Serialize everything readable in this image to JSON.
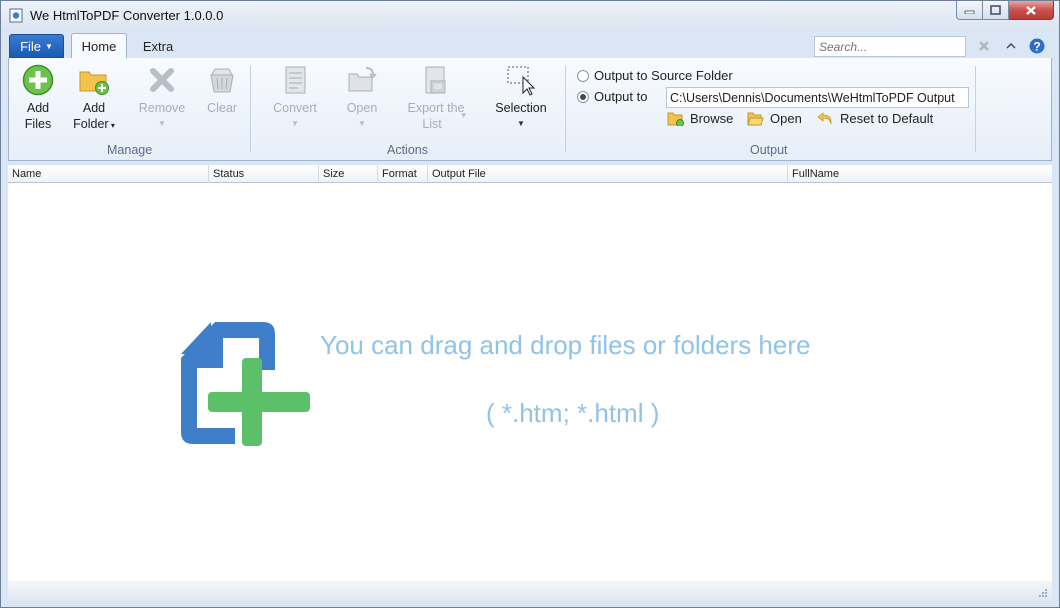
{
  "window": {
    "title": "We HtmlToPDF Converter 1.0.0.0"
  },
  "tabs": {
    "file": "File",
    "home": "Home",
    "extra": "Extra"
  },
  "search": {
    "placeholder": "Search..."
  },
  "ribbon": {
    "manage": {
      "label": "Manage",
      "add_files": [
        "Add",
        "Files"
      ],
      "add_folder": [
        "Add",
        "Folder"
      ],
      "remove": "Remove",
      "clear": "Clear"
    },
    "actions": {
      "label": "Actions",
      "convert": "Convert",
      "open": "Open",
      "export": [
        "Export the",
        "List"
      ],
      "selection": "Selection"
    },
    "output": {
      "label": "Output",
      "source_folder": "Output to Source Folder",
      "output_to": "Output to",
      "path": "C:\\Users\\Dennis\\Documents\\WeHtmlToPDF Output",
      "browse": "Browse",
      "open": "Open",
      "reset": "Reset to Default",
      "selected": "output_to"
    }
  },
  "columns": [
    "Name",
    "Status",
    "Size",
    "Format",
    "Output File",
    "FullName"
  ],
  "dropzone": {
    "message": "You can drag and drop files or folders here",
    "extensions": "( *.htm; *.html )"
  },
  "colors": {
    "accent": "#1a5bb3",
    "drop_text": "#8fc3e8",
    "doc_blue": "#3f7fc9",
    "plus_green": "#5cc06a"
  },
  "icons": [
    "app-icon",
    "add-files-icon",
    "add-folder-icon",
    "remove-icon",
    "clear-icon",
    "convert-icon",
    "open-icon",
    "export-icon",
    "selection-icon",
    "browse-folder-icon",
    "open-folder-icon",
    "reset-icon",
    "close-x-icon",
    "collapse-ribbon-icon",
    "help-icon",
    "drop-file-icon"
  ]
}
